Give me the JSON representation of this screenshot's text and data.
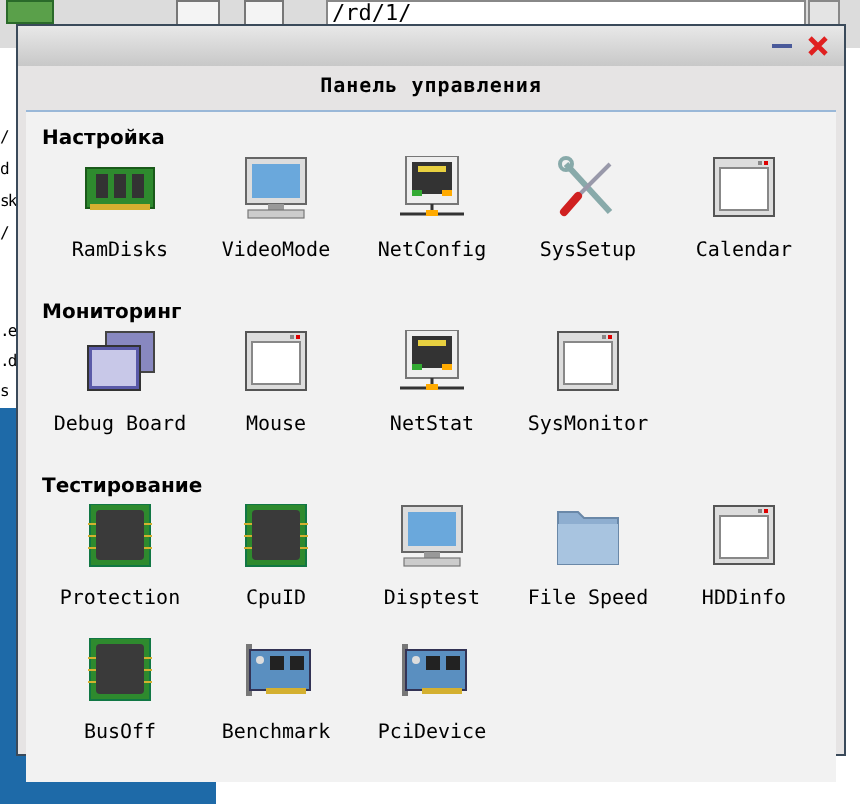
{
  "background": {
    "address": "/rd/1/",
    "left_fragments": [
      "/",
      "d",
      "sk",
      "/",
      ".e",
      ".d",
      "s"
    ]
  },
  "window": {
    "title": "Панель управления"
  },
  "sections": [
    {
      "title": "Настройка",
      "items": [
        {
          "label": "RamDisks"
        },
        {
          "label": "VideoMode"
        },
        {
          "label": "NetConfig"
        },
        {
          "label": "SysSetup"
        },
        {
          "label": "Calendar"
        }
      ]
    },
    {
      "title": "Мониторинг",
      "items": [
        {
          "label": "Debug Board"
        },
        {
          "label": "Mouse"
        },
        {
          "label": "NetStat"
        },
        {
          "label": "SysMonitor"
        }
      ]
    },
    {
      "title": "Тестирование",
      "items": [
        {
          "label": "Protection"
        },
        {
          "label": "CpuID"
        },
        {
          "label": "Disptest"
        },
        {
          "label": "File Speed"
        },
        {
          "label": "HDDinfo"
        },
        {
          "label": "BusOff"
        },
        {
          "label": "Benchmark"
        },
        {
          "label": "PciDevice"
        }
      ]
    }
  ]
}
